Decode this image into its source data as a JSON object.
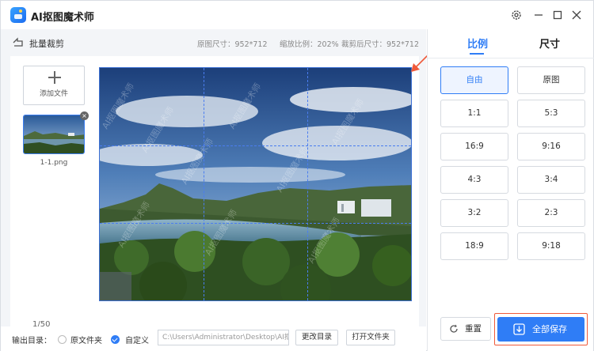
{
  "app": {
    "title": "AI抠图魔术师"
  },
  "toolbar": {
    "back_title": "批量裁剪",
    "original_size": "原图尺寸：952*712",
    "zoom_ratio": "缩放比例：202%",
    "cropped_size": "裁剪后尺寸：952*712"
  },
  "files": {
    "add_label": "添加文件",
    "items": [
      {
        "name": "1-1.png"
      }
    ],
    "pager": "1/50",
    "close_symbol": "×"
  },
  "watermark": "AI抠图魔术师",
  "output": {
    "label": "输出目录：",
    "option_original": "原文件夹",
    "option_custom": "自定义",
    "selected": "自定义",
    "path": "C:\\Users\\Administrator\\Desktop\\AI抠图",
    "change_button": "更改目录",
    "open_button": "打开文件夹"
  },
  "tabs": [
    {
      "label": "比例",
      "active": true
    },
    {
      "label": "尺寸",
      "active": false
    }
  ],
  "ratios": [
    "自由",
    "原图",
    "1:1",
    "5:3",
    "16:9",
    "9:16",
    "4:3",
    "3:4",
    "3:2",
    "2:3",
    "18:9",
    "9:18"
  ],
  "selected_ratio": "自由",
  "actions": {
    "reset": "重置",
    "save_all": "全部保存"
  },
  "colors": {
    "accent": "#2f7df6",
    "highlight": "#f05a3a"
  }
}
